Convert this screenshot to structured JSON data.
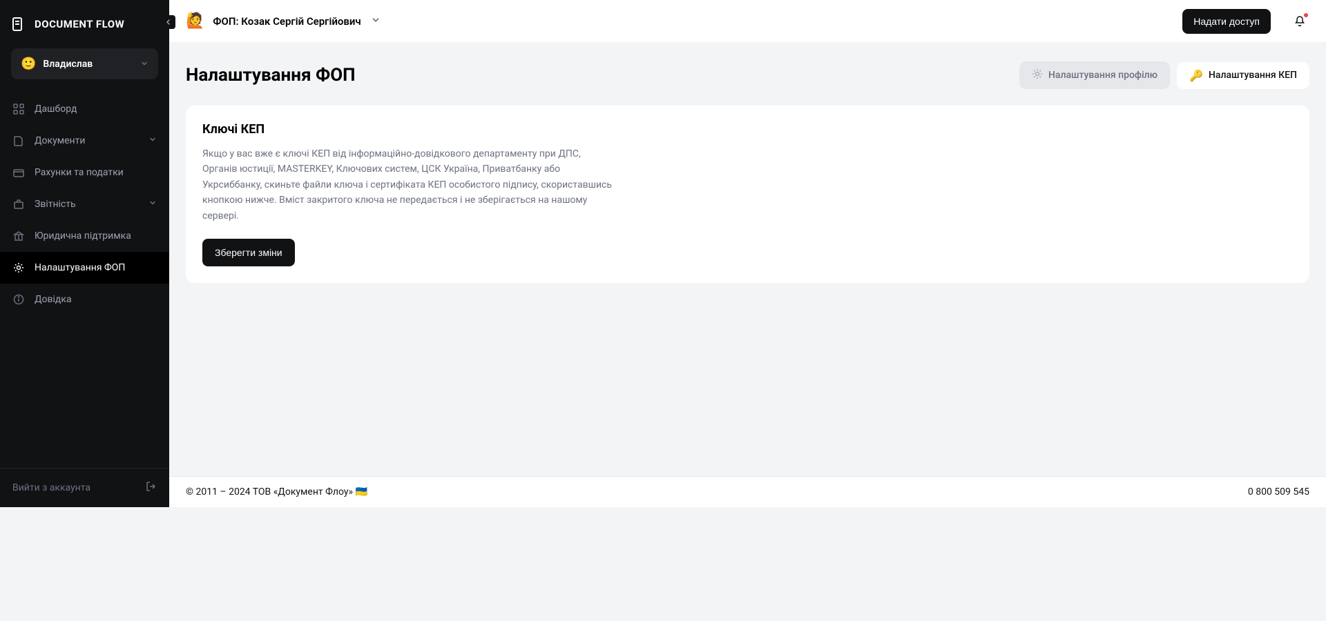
{
  "app": {
    "title": "DOCUMENT FLOW"
  },
  "user": {
    "name": "Владислав",
    "emoji": "🙂"
  },
  "nav": {
    "items": [
      {
        "label": "Дашборд"
      },
      {
        "label": "Документи"
      },
      {
        "label": "Рахунки та податки"
      },
      {
        "label": "Звітність"
      },
      {
        "label": "Юридична підтримка"
      },
      {
        "label": "Налаштування ФОП"
      },
      {
        "label": "Довідка"
      }
    ],
    "logout": "Вийти з аккаунта"
  },
  "header": {
    "fop_emoji": "🙋",
    "fop_label": "ФОП: Козак Сергій Сергійович",
    "grant_label": "Надати доступ"
  },
  "page": {
    "title": "Налаштування ФОП",
    "tabs": [
      {
        "icon": "⚙️",
        "label": "Налаштування профілю"
      },
      {
        "icon": "🔑",
        "label": "Налаштування КЕП"
      }
    ]
  },
  "card": {
    "title": "Ключі КЕП",
    "desc": "Якщо у вас вже є ключі КЕП від інформаційно-довідкового департаменту при ДПС, Органів юстиції, MASTERKEY, Ключових систем, ЦСК Україна, Приватбанку або Укрсиббанку, скиньте файли ключа і сертифіката КЕП особистого підпису, скориставшись кнопкою нижче. Вміст закритого ключа не передається і не зберігається на нашому сервері.",
    "save_label": "Зберегти зміни"
  },
  "footer": {
    "copyright": "© 2011 – 2024 ТОВ «Документ Флоу»  🇺🇦",
    "phone": "0 800 509 545"
  }
}
